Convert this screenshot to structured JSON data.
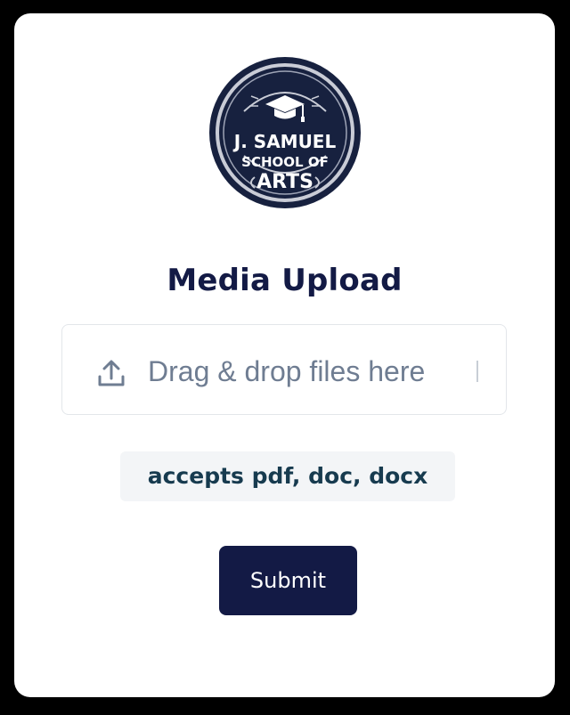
{
  "logo": {
    "line1": "J. SAMUEL",
    "line2": "SCHOOL OF",
    "line3": "ARTS",
    "icon": "graduation-cap-icon"
  },
  "title": "Media Upload",
  "dropzone": {
    "text": "Drag & drop files here",
    "icon": "upload-icon"
  },
  "accepts_text": "accepts pdf, doc, docx",
  "submit_label": "Submit",
  "colors": {
    "brand_navy": "#131a45",
    "accent_teal": "#173b4f",
    "muted_text": "#6f7d92",
    "page_background": "#000000",
    "card_background": "#ffffff"
  }
}
